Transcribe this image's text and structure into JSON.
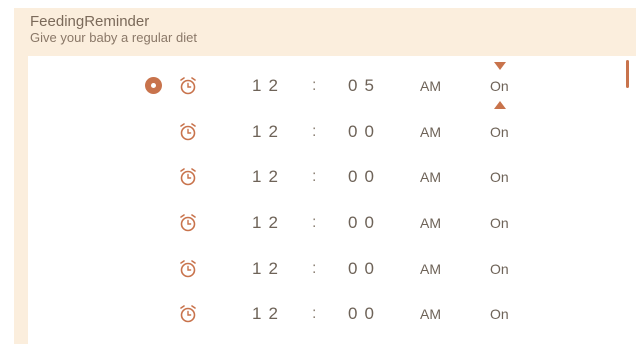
{
  "header": {
    "title": "FeedingReminder",
    "subtitle": "Give your baby a regular diet"
  },
  "colors": {
    "accent": "#c8734c",
    "panel": "#fbeedd",
    "text": "#6e6358"
  },
  "reminders": [
    {
      "hour": "12",
      "minute": "05",
      "period": "AM",
      "state": "On",
      "selected": true
    },
    {
      "hour": "12",
      "minute": "00",
      "period": "AM",
      "state": "On",
      "selected": false
    },
    {
      "hour": "12",
      "minute": "00",
      "period": "AM",
      "state": "On",
      "selected": false
    },
    {
      "hour": "12",
      "minute": "00",
      "period": "AM",
      "state": "On",
      "selected": false
    },
    {
      "hour": "12",
      "minute": "00",
      "period": "AM",
      "state": "On",
      "selected": false
    },
    {
      "hour": "12",
      "minute": "00",
      "period": "AM",
      "state": "On",
      "selected": false
    }
  ],
  "separator": ":",
  "icons": {
    "row_icon": "alarm-clock-icon",
    "up": "arrow-up-icon",
    "down": "arrow-down-icon"
  }
}
